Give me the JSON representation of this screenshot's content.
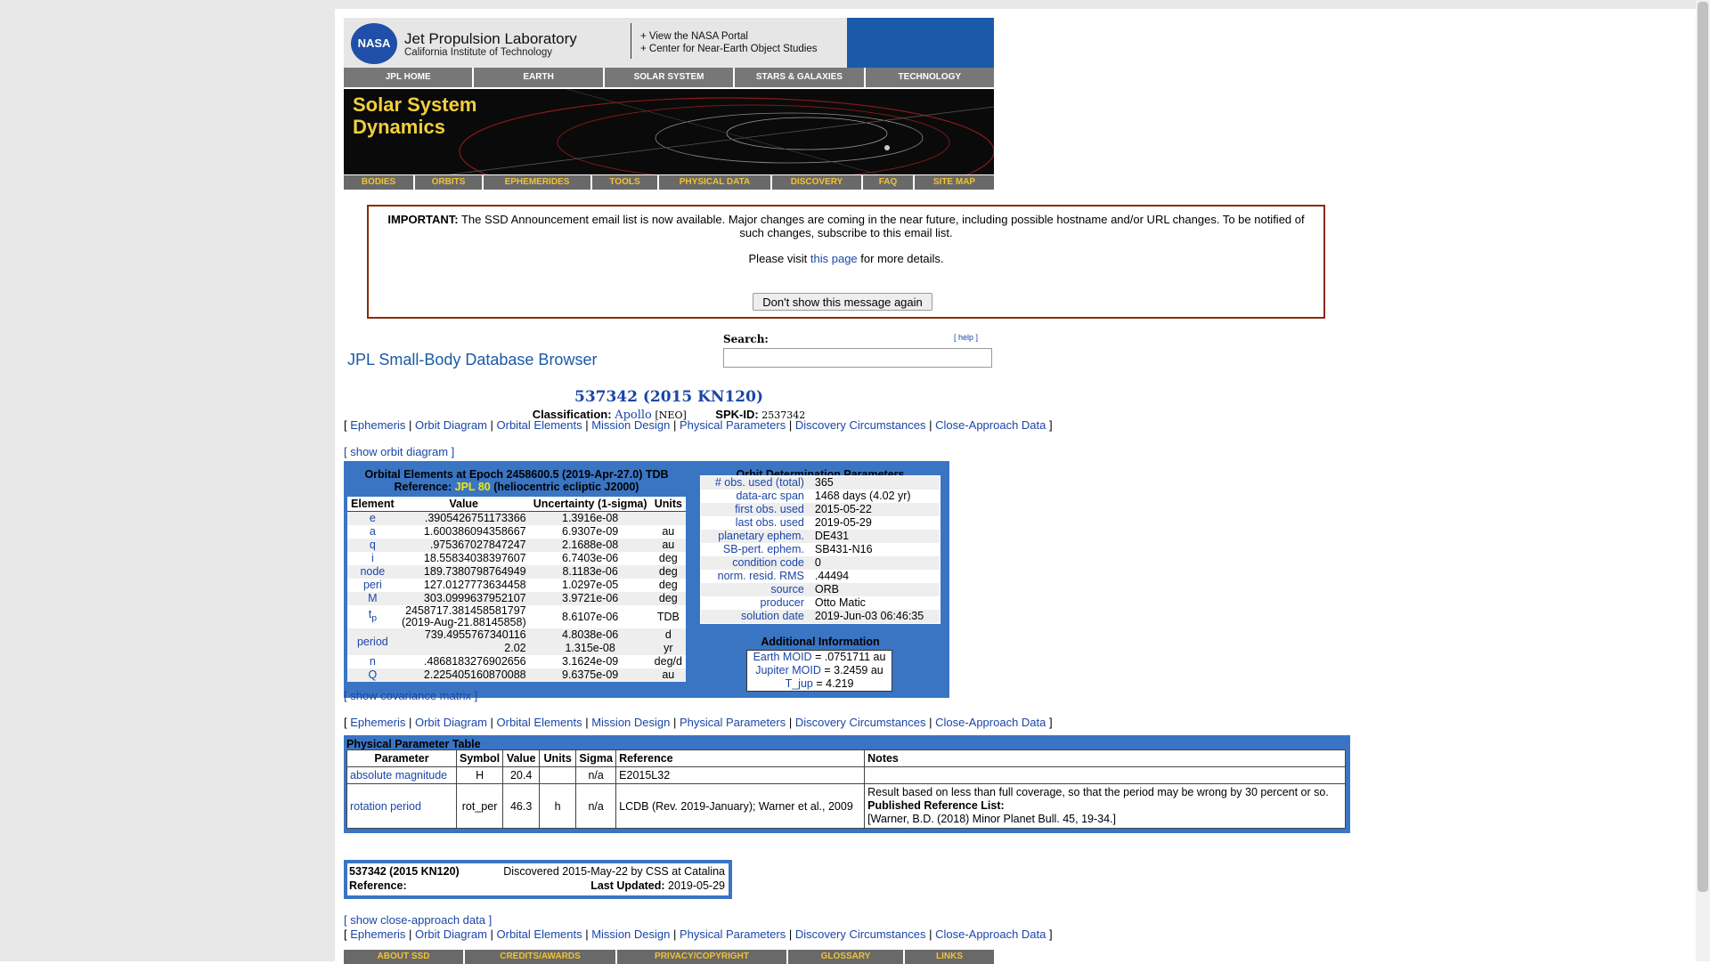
{
  "header": {
    "logo": "NASA",
    "org_name": "Jet Propulsion Laboratory",
    "org_sub": "California Institute of Technology",
    "link_portal": "+ View the NASA Portal",
    "link_neo": "+ Center for Near-Earth Object Studies"
  },
  "top_nav": [
    "JPL HOME",
    "EARTH",
    "SOLAR SYSTEM",
    "STARS & GALAXIES",
    "TECHNOLOGY"
  ],
  "banner": {
    "line1": "Solar System",
    "line2": "Dynamics"
  },
  "ssd_nav": [
    "BODIES",
    "ORBITS",
    "EPHEMERIDES",
    "TOOLS",
    "PHYSICAL DATA",
    "DISCOVERY",
    "FAQ",
    "SITE MAP"
  ],
  "notice": {
    "important": "IMPORTANT:",
    "text": "The SSD Announcement email list is now available. Major changes are coming in the near future, including possible hostname and/or URL changes. To be notified of such changes, subscribe to this email list.",
    "visit_pre": "Please visit",
    "visit_link": "this page",
    "visit_post": "for more details.",
    "button": "Don't show this message again"
  },
  "browser": {
    "title": "JPL Small-Body Database Browser",
    "search_label": "Search:",
    "help": "[ help ]"
  },
  "object": {
    "name": "537342 (2015 KN120)",
    "class_label": "Classification:",
    "class_value": "Apollo",
    "class_tag": "[NEO]",
    "spk_label": "SPK-ID:",
    "spk_value": "2537342"
  },
  "tabs": [
    "Ephemeris",
    "Orbit Diagram",
    "Orbital Elements",
    "Mission Design",
    "Physical Parameters",
    "Discovery Circumstances",
    "Close-Approach Data"
  ],
  "show_orbit": "[ show orbit diagram ]",
  "orbital": {
    "title": "Orbital Elements at Epoch 2458600.5 (2019-Apr-27.0) TDB",
    "ref_label": "Reference:",
    "ref_value": "JPL 80",
    "ref_post": "(heliocentric ecliptic J2000)",
    "headers": [
      "Element",
      "Value",
      "Uncertainty (1-sigma)",
      "Units"
    ],
    "rows": [
      {
        "el": "e",
        "val": ".3905426751173366",
        "unc": "1.3916e-08",
        "unit": ""
      },
      {
        "el": "a",
        "val": "1.600386094358667",
        "unc": "6.9307e-09",
        "unit": "au"
      },
      {
        "el": "q",
        "val": ".975367027847247",
        "unc": "2.1688e-08",
        "unit": "au"
      },
      {
        "el": "i",
        "val": "18.55834038397607",
        "unc": "6.7403e-06",
        "unit": "deg"
      },
      {
        "el": "node",
        "val": "189.7380798764949",
        "unc": "8.1183e-06",
        "unit": "deg"
      },
      {
        "el": "peri",
        "val": "127.0127773634458",
        "unc": "1.0297e-05",
        "unit": "deg"
      },
      {
        "el": "M",
        "val": "303.0999637952107",
        "unc": "3.9721e-06",
        "unit": "deg"
      }
    ],
    "tp": {
      "el": "t",
      "sub": "p",
      "val1": "2458717.381458581797",
      "val2": "(2019-Aug-21.88145858)",
      "unc": "8.6107e-06",
      "unit": "TDB"
    },
    "period": {
      "el": "period",
      "val1": "739.4955767340116",
      "val2": "2.02",
      "unc1": "4.8038e-06",
      "unc2": "1.315e-08",
      "unit1": "d",
      "unit2": "yr"
    },
    "rows2": [
      {
        "el": "n",
        "val": ".4868183276902656",
        "unc": "3.1624e-09",
        "unit": "deg/d"
      },
      {
        "el": "Q",
        "val": "2.225405160870088",
        "unc": "9.6375e-09",
        "unit": "au"
      }
    ]
  },
  "od": {
    "title": "Orbit Determination Parameters",
    "rows": [
      {
        "k": "# obs. used (total)",
        "v": "365"
      },
      {
        "k": "data-arc span",
        "v": "1468 days (4.02 yr)"
      },
      {
        "k": "first obs. used",
        "v": "2015-05-22"
      },
      {
        "k": "last obs. used",
        "v": "2019-05-29"
      },
      {
        "k": "planetary ephem.",
        "v": "DE431"
      },
      {
        "k": "SB-pert. ephem.",
        "v": "SB431-N16"
      },
      {
        "k": "condition code",
        "v": "0"
      },
      {
        "k": "norm. resid. RMS",
        "v": ".44494"
      },
      {
        "k": "source",
        "v": "ORB"
      },
      {
        "k": "producer",
        "v": "Otto Matic"
      },
      {
        "k": "solution date",
        "v": "2019-Jun-03 06:46:35"
      }
    ]
  },
  "additional": {
    "title": "Additional Information",
    "earth_moid_label": "Earth MOID",
    "earth_moid": "= .0751711 au",
    "jupiter_moid_label": "Jupiter MOID",
    "jupiter_moid": "= 3.2459 au",
    "tjup_label": "T_jup",
    "tjup": "= 4.219"
  },
  "show_cov": "[ show covariance matrix ]",
  "physical": {
    "title": "Physical Parameter Table",
    "headers": [
      "Parameter",
      "Symbol",
      "Value",
      "Units",
      "Sigma",
      "Reference",
      "Notes"
    ],
    "row1": {
      "param": "absolute magnitude",
      "sym": "H",
      "val": "20.4",
      "unit": "",
      "sigma": "n/a",
      "ref": "E2015L32",
      "notes": ""
    },
    "row2": {
      "param": "rotation period",
      "sym": "rot_per",
      "val": "46.3",
      "unit": "h",
      "sigma": "n/a",
      "ref": "LCDB (Rev. 2019-January); Warner et al., 2009",
      "note1": "Result based on less than full coverage, so that the period may be wrong by 30 percent or so.",
      "note2": "Published Reference List:",
      "note3": "[Warner, B.D. (2018) Minor Planet Bull. 45, 19-34.]"
    }
  },
  "discovery": {
    "name": "537342 (2015 KN120)",
    "discovered": "Discovered 2015-May-22 by CSS at Catalina",
    "ref_label": "Reference:",
    "updated_label": "Last Updated:",
    "updated_value": "2019-05-29"
  },
  "show_ca": "[ show close-approach data ]",
  "footer_nav": [
    "ABOUT SSD",
    "CREDITS/AWARDS",
    "PRIVACY/COPYRIGHT",
    "GLOSSARY",
    "LINKS"
  ],
  "colors": {
    "link": "#1b46a8",
    "box_blue": "#3a75c4",
    "nav_gold": "#f1c232",
    "notice_border": "#8a2b0a"
  }
}
